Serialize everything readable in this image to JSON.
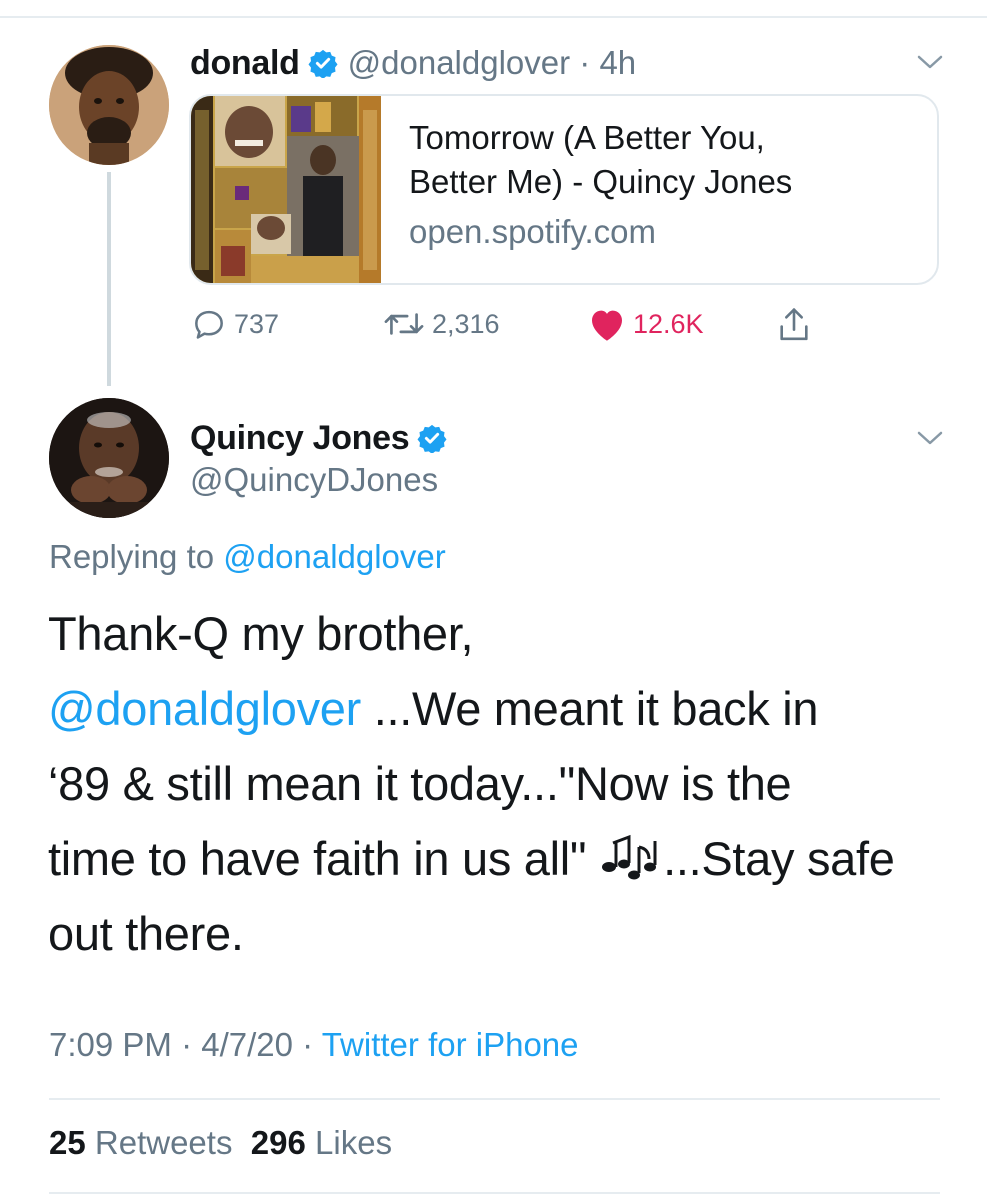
{
  "parent_tweet": {
    "display_name": "donald",
    "handle_time": "@donaldglover · 4h",
    "avatar": "portrait-donald-avatar",
    "card": {
      "title_line1": "Tomorrow (A Better You,",
      "title_line2": "Better Me) - Quincy Jones",
      "domain": "open.spotify.com",
      "image": "album-art-back-on-the-block"
    },
    "actions": {
      "reply_count": "737",
      "retweet_count": "2,316",
      "like_count": "12.6K"
    }
  },
  "reply_tweet": {
    "display_name": "Quincy Jones",
    "handle": "@QuincyDJones",
    "avatar": "portrait-quincy-avatar",
    "replying_prefix": "Replying to",
    "replying_to": "@donaldglover",
    "text": {
      "line1": "Thank-Q my brother,",
      "mention": "@donaldglover",
      "line2_rest": " ...We meant it back in",
      "line3": "‘89 & still mean it today...\"Now is the",
      "line4_a": "time to have faith in us all\" ",
      "line4_b": "...Stay safe",
      "line5": "out there."
    },
    "time": "7:09 PM",
    "date": "4/7/20",
    "sep": " · ",
    "source": "Twitter for iPhone",
    "retweets_count": "25",
    "retweets_label": "Retweets",
    "likes_count": "296",
    "likes_label": "Likes"
  },
  "colors": {
    "link": "#1da1f2",
    "muted": "#657786",
    "like": "#e0245e",
    "verified": "#1da1f2"
  }
}
